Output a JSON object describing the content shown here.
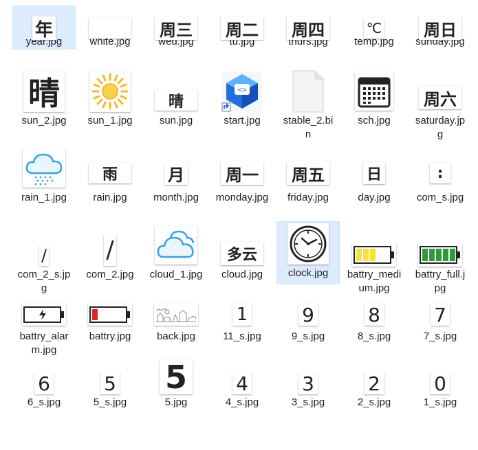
{
  "files": [
    {
      "name": "year.jpg",
      "thumb": "年"
    },
    {
      "name": "white.jpg",
      "thumb": ""
    },
    {
      "name": "wed.jpg",
      "thumb": "周三"
    },
    {
      "name": "tu.jpg",
      "thumb": "周二"
    },
    {
      "name": "thurs.jpg",
      "thumb": "周四"
    },
    {
      "name": "temp.jpg",
      "thumb": "℃"
    },
    {
      "name": "sunday.jpg",
      "thumb": "周日"
    },
    {
      "name": "sun_2.jpg",
      "thumb": "晴"
    },
    {
      "name": "sun_1.jpg",
      "thumb": ""
    },
    {
      "name": "sun.jpg",
      "thumb": "晴"
    },
    {
      "name": "start.jpg",
      "thumb": ""
    },
    {
      "name": "stable_2.bin",
      "thumb": ""
    },
    {
      "name": "sch.jpg",
      "thumb": ""
    },
    {
      "name": "saturday.jpg",
      "thumb": "周六"
    },
    {
      "name": "rain_1.jpg",
      "thumb": ""
    },
    {
      "name": "rain.jpg",
      "thumb": "雨"
    },
    {
      "name": "month.jpg",
      "thumb": "月"
    },
    {
      "name": "monday.jpg",
      "thumb": "周一"
    },
    {
      "name": "friday.jpg",
      "thumb": "周五"
    },
    {
      "name": "day.jpg",
      "thumb": "日"
    },
    {
      "name": "com_s.jpg",
      "thumb": ":"
    },
    {
      "name": "com_2_s.jpg",
      "thumb": "/"
    },
    {
      "name": "com_2.jpg",
      "thumb": "/"
    },
    {
      "name": "cloud_1.jpg",
      "thumb": ""
    },
    {
      "name": "cloud.jpg",
      "thumb": "多云"
    },
    {
      "name": "clock.jpg",
      "thumb": ""
    },
    {
      "name": "battry_medium.jpg",
      "thumb": ""
    },
    {
      "name": "battry_full.jpg",
      "thumb": ""
    },
    {
      "name": "battry_alarm.jpg",
      "thumb": ""
    },
    {
      "name": "battry.jpg",
      "thumb": ""
    },
    {
      "name": "back.jpg",
      "thumb": ""
    },
    {
      "name": "11_s.jpg",
      "thumb": "1"
    },
    {
      "name": "9_s.jpg",
      "thumb": "9"
    },
    {
      "name": "8_s.jpg",
      "thumb": "8"
    },
    {
      "name": "7_s.jpg",
      "thumb": "7"
    },
    {
      "name": "6_s.jpg",
      "thumb": "6"
    },
    {
      "name": "5_s.jpg",
      "thumb": "5"
    },
    {
      "name": "5.jpg",
      "thumb": "5"
    },
    {
      "name": "4_s.jpg",
      "thumb": "4"
    },
    {
      "name": "3_s.jpg",
      "thumb": "3"
    },
    {
      "name": "2_s.jpg",
      "thumb": "2"
    },
    {
      "name": "1_s.jpg",
      "thumb": "0"
    }
  ],
  "colors": {
    "selection": "#dcecfc",
    "hover": "#e5f3ff",
    "battery_yellow": "#f5e23a",
    "battery_green": "#2f9a3a",
    "battery_red": "#d9262a",
    "sky_blue": "#3aa0e0"
  }
}
